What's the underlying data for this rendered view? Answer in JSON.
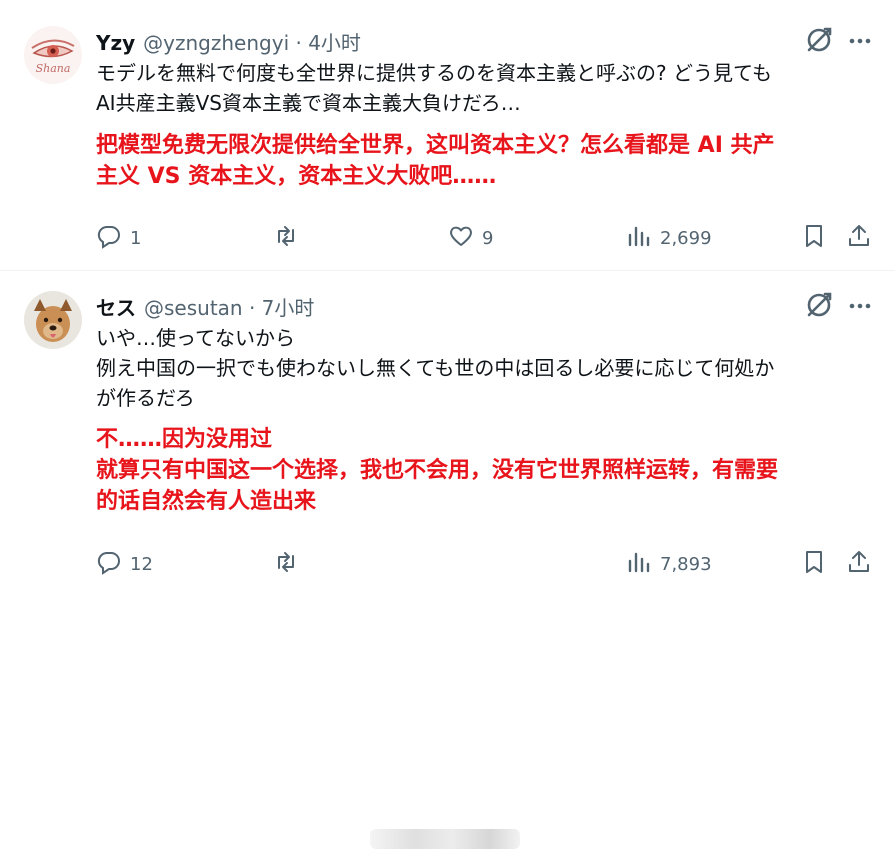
{
  "tweets": [
    {
      "name": "Yzy",
      "handle": "@yzngzhengyi",
      "time": "4小时",
      "avatar_text": "Shana",
      "text_lines": [
        "モデルを無料で何度も全世界に提供するのを資本主義と呼ぶの? どう見ても",
        "AI共産主義VS資本主義で資本主義大負けだろ…"
      ],
      "translation_lines": [
        "把模型免费无限次提供给全世界，这叫资本主义？怎么看都是 AI 共产",
        "主义 VS 资本主义，资本主义大败吧……"
      ],
      "stats": {
        "replies": "1",
        "retweets": "",
        "likes": "9",
        "views": "2,699"
      }
    },
    {
      "name": "セス",
      "handle": "@sesutan",
      "time": "7小时",
      "text_lines": [
        "いや…使ってないから",
        "例え中国の一択でも使わないし無くても世の中は回るし必要に応じて何処か",
        "が作るだろ"
      ],
      "translation_lines": [
        "不……因为没用过",
        "就算只有中国这一个选择，我也不会用，没有它世界照样运转，有需要",
        "的话自然会有人造出来"
      ],
      "stats": {
        "replies": "12",
        "retweets": "",
        "likes": "",
        "views": "7,893"
      }
    }
  ],
  "colors": {
    "translation": "#e8141b",
    "muted": "#536471",
    "text": "#0f1419"
  },
  "icons": [
    "grok-icon",
    "more-icon",
    "reply-icon",
    "retweet-icon",
    "like-icon",
    "views-icon",
    "bookmark-icon",
    "share-icon"
  ]
}
